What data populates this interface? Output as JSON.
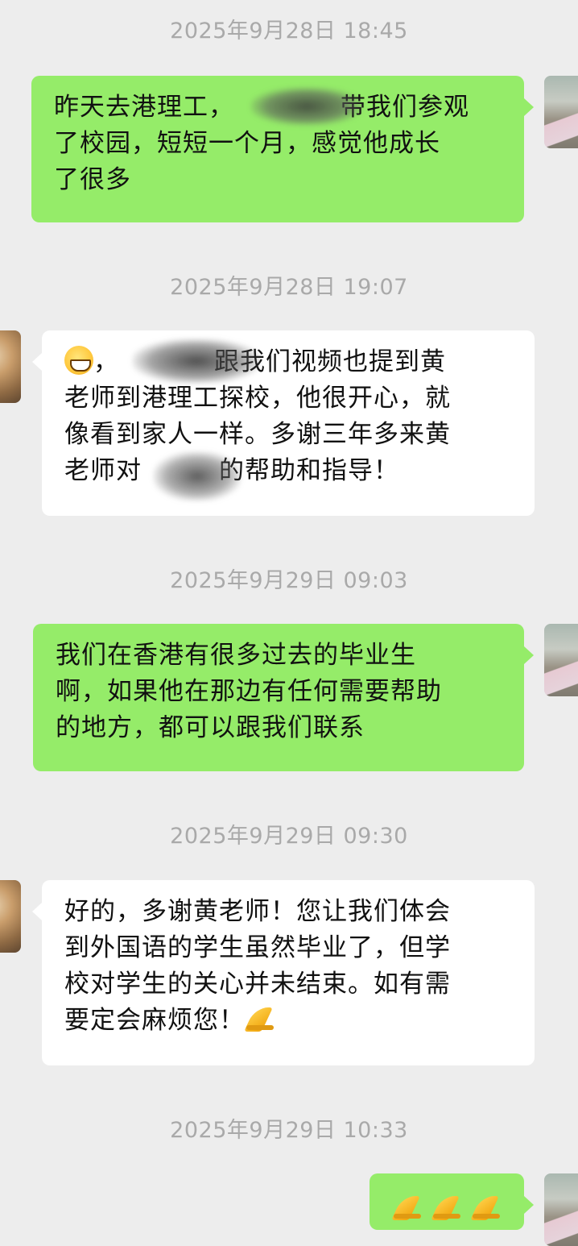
{
  "messages": [
    {
      "timestamp": "2025年9月28日 18:45",
      "side": "out",
      "lines": [
        "昨天去港理工，",
        "带我们参观",
        "了校园，短短一个月，感觉他成长",
        "了很多"
      ]
    },
    {
      "timestamp": "2025年9月28日 19:07",
      "side": "in",
      "emoji": "grinning-face",
      "lines": [
        "，",
        "跟我们视频也提到黄",
        "老师到港理工探校，他很开心，就",
        "像看到家人一样。多谢三年多来黄",
        "老师对",
        "的帮助和指导！"
      ]
    },
    {
      "timestamp": "2025年9月29日 09:03",
      "side": "out",
      "lines": [
        "我们在香港有很多过去的毕业生",
        "啊，如果他在那边有任何需要帮助",
        "的地方，都可以跟我们联系"
      ]
    },
    {
      "timestamp": "2025年9月29日 09:30",
      "side": "in",
      "emoji": "folded-hands",
      "lines": [
        "好的，多谢黄老师！您让我们体会",
        "到外国语的学生虽然毕业了，但学",
        "校对学生的关心并未结束。如有需",
        "要定会麻烦您！"
      ]
    },
    {
      "timestamp": "2025年9月29日 10:33",
      "side": "out",
      "emoji": "folded-hands"
    }
  ],
  "colors": {
    "outgoing_bubble": "#95ec69",
    "incoming_bubble": "#ffffff",
    "background": "#ededed",
    "timestamp_text": "#a9a9a9"
  }
}
